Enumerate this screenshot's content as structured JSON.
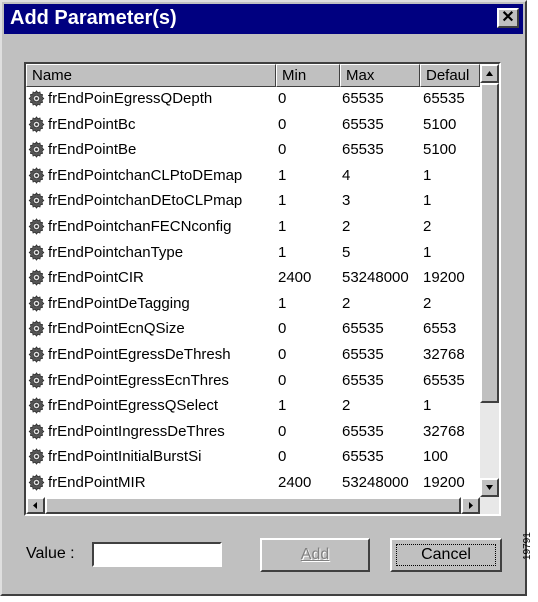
{
  "dialog": {
    "title": "Add Parameter(s)",
    "close_label": "✕"
  },
  "list": {
    "columns": {
      "name": "Name",
      "min": "Min",
      "max": "Max",
      "default": "Defaul"
    },
    "rows": [
      {
        "name": "frEndPoinEgressQDepth",
        "min": "0",
        "max": "65535",
        "default": "65535"
      },
      {
        "name": "frEndPointBc",
        "min": "0",
        "max": "65535",
        "default": "5100"
      },
      {
        "name": "frEndPointBe",
        "min": "0",
        "max": "65535",
        "default": "5100"
      },
      {
        "name": "frEndPointchanCLPtoDEmap",
        "min": "1",
        "max": "4",
        "default": "1"
      },
      {
        "name": "frEndPointchanDEtoCLPmap",
        "min": "1",
        "max": "3",
        "default": "1"
      },
      {
        "name": "frEndPointchanFECNconfig",
        "min": "1",
        "max": "2",
        "default": "2"
      },
      {
        "name": "frEndPointchanType",
        "min": "1",
        "max": "5",
        "default": "1"
      },
      {
        "name": "frEndPointCIR",
        "min": "2400",
        "max": "53248000",
        "default": "19200"
      },
      {
        "name": "frEndPointDeTagging",
        "min": "1",
        "max": "2",
        "default": "2"
      },
      {
        "name": "frEndPointEcnQSize",
        "min": "0",
        "max": "65535",
        "default": "6553"
      },
      {
        "name": "frEndPointEgressDeThresh",
        "min": "0",
        "max": "65535",
        "default": "32768"
      },
      {
        "name": "frEndPointEgressEcnThres",
        "min": "0",
        "max": "65535",
        "default": "65535"
      },
      {
        "name": "frEndPointEgressQSelect",
        "min": "1",
        "max": "2",
        "default": "1"
      },
      {
        "name": "frEndPointIngressDeThres",
        "min": "0",
        "max": "65535",
        "default": "32768"
      },
      {
        "name": "frEndPointInitialBurstSi",
        "min": "0",
        "max": "65535",
        "default": "100"
      },
      {
        "name": "frEndPointMIR",
        "min": "2400",
        "max": "53248000",
        "default": "19200"
      }
    ],
    "icon": "gear-icon"
  },
  "form": {
    "value_label": "Value :",
    "value": "",
    "add_label": "Add",
    "cancel_label": "Cancel"
  },
  "side_mark": "19791"
}
